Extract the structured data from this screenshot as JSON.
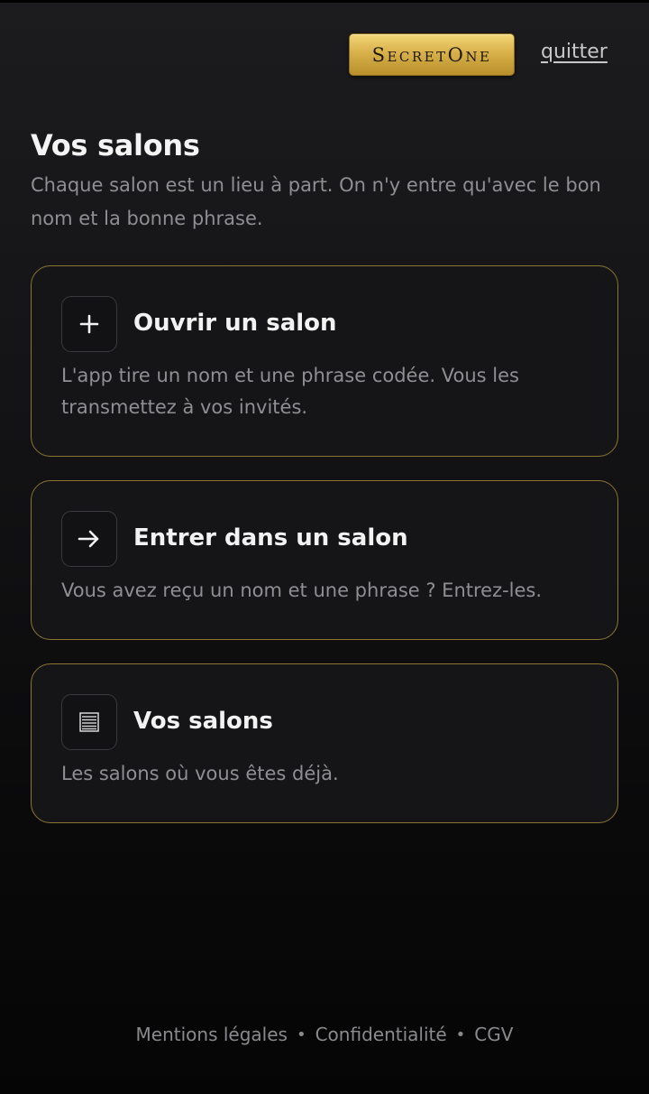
{
  "header": {
    "brand_label": "SecretOne",
    "quit_label": "quitter"
  },
  "main": {
    "title": "Vos salons",
    "subtitle": "Chaque salon est un lieu à part. On n'y entre qu'avec le bon nom et la bonne phrase."
  },
  "cards": [
    {
      "icon": "plus-icon",
      "title": "Ouvrir un salon",
      "description": "L'app tire un nom et une phrase codée. Vous les transmettez à vos invités."
    },
    {
      "icon": "arrow-right-icon",
      "title": "Entrer dans un salon",
      "description": "Vous avez reçu un nom et une phrase ? Entrez-les."
    },
    {
      "icon": "list-icon",
      "title": "Vos salons",
      "description": "Les salons où vous êtes déjà."
    }
  ],
  "footer": {
    "links": [
      "Mentions légales",
      "Confidentialité",
      "CGV"
    ],
    "separator": "•"
  },
  "colors": {
    "accent_gold": "#d9b14a",
    "card_border": "#8c7433",
    "background": "#0b0b0c"
  }
}
